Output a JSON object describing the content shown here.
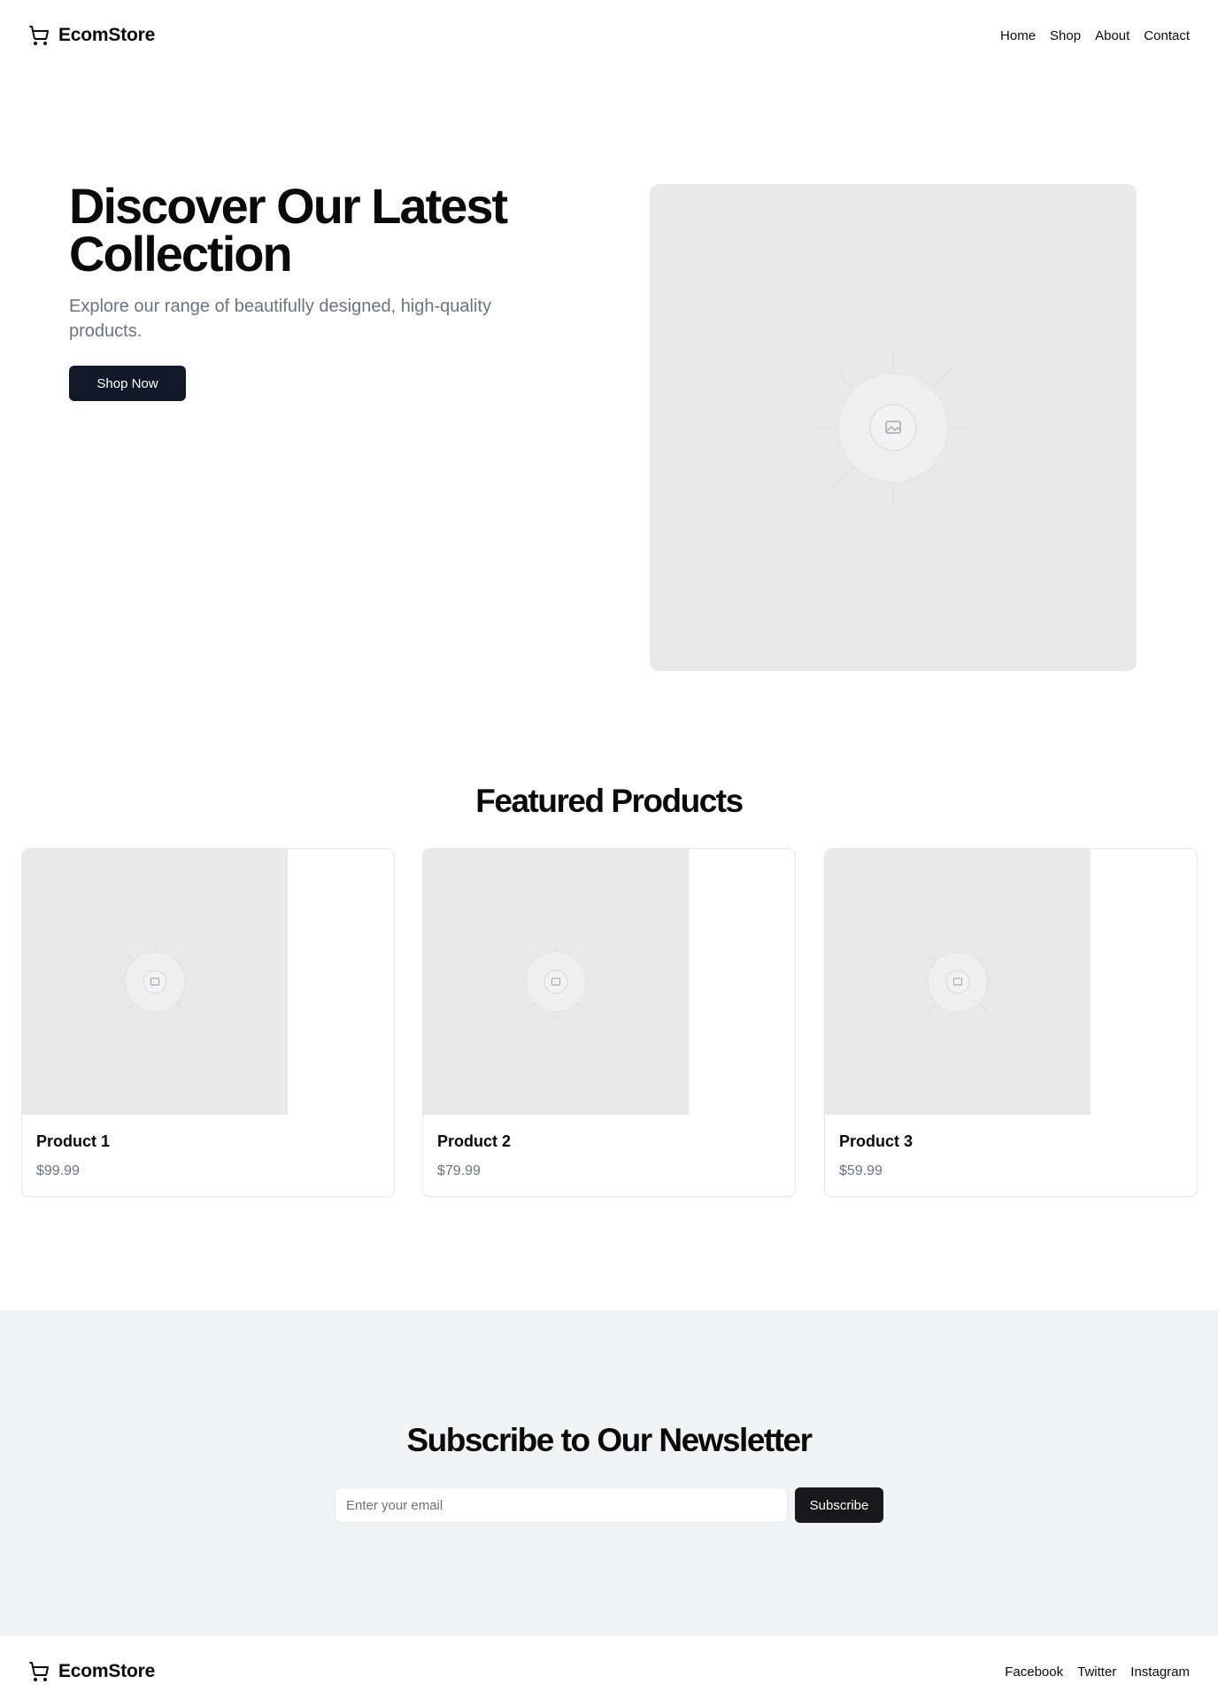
{
  "header": {
    "brand": "EcomStore",
    "brand_icon": "shopping-cart-icon",
    "nav": [
      {
        "label": "Home"
      },
      {
        "label": "Shop"
      },
      {
        "label": "About"
      },
      {
        "label": "Contact"
      }
    ]
  },
  "hero": {
    "title": "Discover Our Latest Collection",
    "subtitle": "Explore our range of beautifully designed, high-quality products.",
    "cta_label": "Shop Now",
    "image_icon": "image-placeholder-icon"
  },
  "featured": {
    "title": "Featured Products",
    "products": [
      {
        "name": "Product 1",
        "price": "$99.99"
      },
      {
        "name": "Product 2",
        "price": "$79.99"
      },
      {
        "name": "Product 3",
        "price": "$59.99"
      }
    ]
  },
  "newsletter": {
    "title": "Subscribe to Our Newsletter",
    "email_placeholder": "Enter your email",
    "button_label": "Subscribe"
  },
  "footer": {
    "brand": "EcomStore",
    "links": [
      {
        "label": "Facebook"
      },
      {
        "label": "Twitter"
      },
      {
        "label": "Instagram"
      }
    ]
  },
  "colors": {
    "primary_button": "#111827",
    "muted_text": "#6b7280",
    "placeholder_bg": "#e9e9ea",
    "newsletter_bg": "#f2f3f5"
  }
}
